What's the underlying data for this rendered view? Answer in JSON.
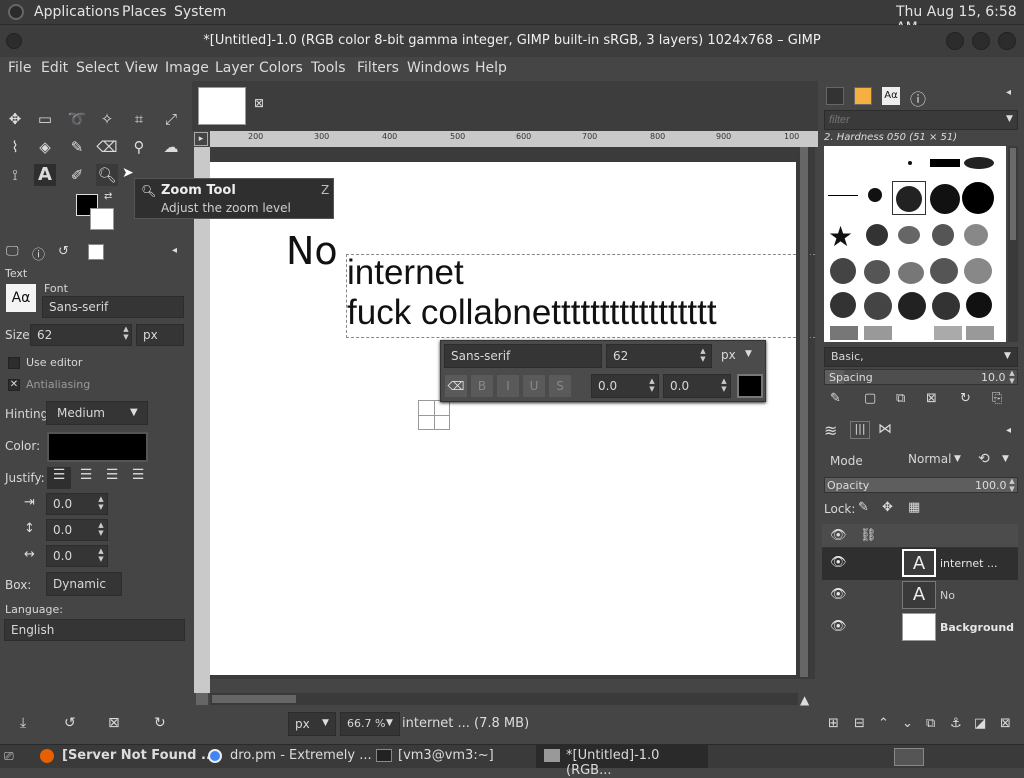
{
  "topbar": {
    "menus": [
      "Applications",
      "Places",
      "System"
    ],
    "clock": "Thu Aug 15,  6:58 AM"
  },
  "window": {
    "title": "*[Untitled]-1.0 (RGB color 8-bit gamma integer, GIMP built-in sRGB, 3 layers) 1024x768 – GIMP"
  },
  "menubar": [
    "File",
    "Edit",
    "Select",
    "View",
    "Image",
    "Layer",
    "Colors",
    "Tools",
    "Filters",
    "Windows",
    "Help"
  ],
  "tooltip": {
    "title": "Zoom Tool",
    "shortcut": "Z",
    "description": "Adjust the zoom level"
  },
  "tool_options": {
    "header": "Text",
    "font_label": "Font",
    "font_value": "Sans-serif",
    "font_preview": "Aα",
    "size_label": "Size:",
    "size_value": "62",
    "size_unit": "px",
    "use_editor": "Use editor",
    "antialiasing": "Antialiasing",
    "hinting_label": "Hinting:",
    "hinting_value": "Medium",
    "color_label": "Color:",
    "color_value": "#000000",
    "justify_label": "Justify:",
    "indent": "0.0",
    "line_spacing": "0.0",
    "letter_spacing": "0.0",
    "box_label": "Box:",
    "box_value": "Dynamic",
    "language_label": "Language:",
    "language_value": "English"
  },
  "canvas": {
    "text_no": "No",
    "text_line1": "internet",
    "text_line2": "fuck collabnettttttttttttttttt",
    "ruler_labels": [
      "200",
      "300",
      "400",
      "500",
      "600",
      "700",
      "800",
      "900",
      "100"
    ]
  },
  "text_toolbar": {
    "font": "Sans-serif",
    "size": "62",
    "unit": "px",
    "baseline": "0.0",
    "kerning": "0.0"
  },
  "statusbar": {
    "unit": "px",
    "zoom": "66.7 %",
    "message": "internet ... (7.8 MB)"
  },
  "brushes": {
    "filter_placeholder": "filter",
    "current": "2. Hardness 050 (51 × 51)",
    "tag": "Basic,",
    "spacing_label": "Spacing",
    "spacing_value": "10.0"
  },
  "layers": {
    "mode_label": "Mode",
    "mode_value": "Normal",
    "opacity_label": "Opacity",
    "opacity_value": "100.0",
    "lock_label": "Lock:",
    "items": [
      {
        "name": "internet ...",
        "type": "text"
      },
      {
        "name": "No",
        "type": "text"
      },
      {
        "name": "Background",
        "type": "image"
      }
    ]
  },
  "taskbar": {
    "items": [
      "[Server Not Found ...",
      "dro.pm - Extremely ...",
      "[vm3@vm3:~]",
      "*[Untitled]-1.0 (RGB..."
    ]
  },
  "colors": {
    "foreground": "#000000",
    "background": "#ffffff",
    "accent": "#4a4a4a"
  }
}
